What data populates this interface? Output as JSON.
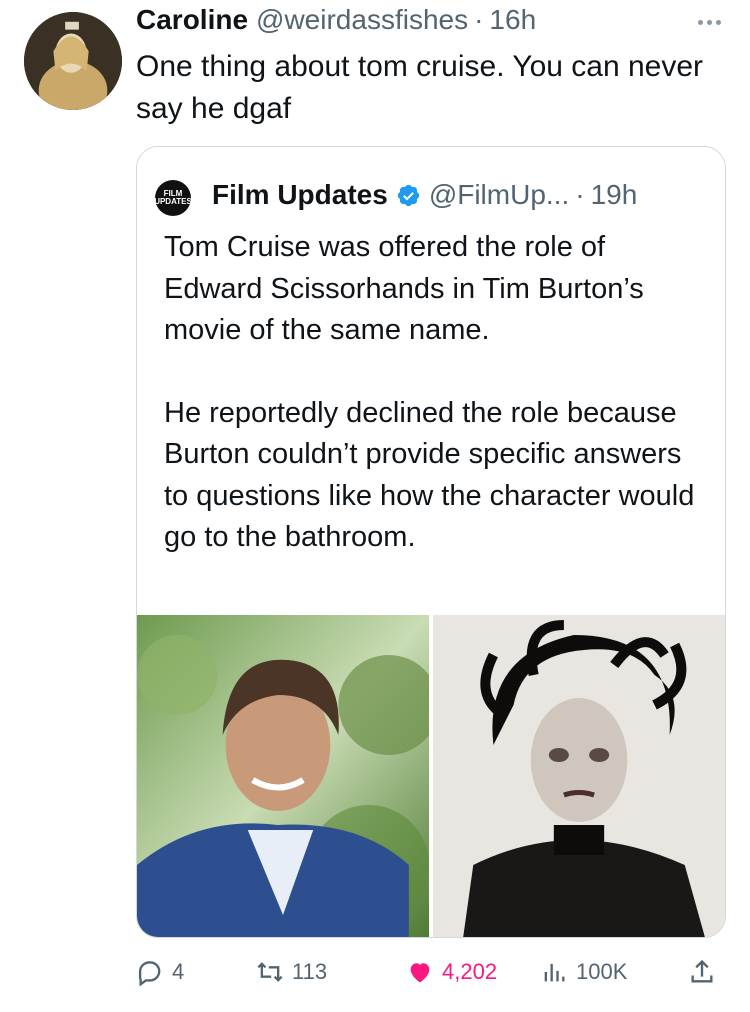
{
  "tweet": {
    "author_name": "Caroline",
    "author_handle": "@weirdassfishes",
    "separator": "·",
    "time": "16h",
    "text": "One thing about tom cruise. You can never say he dgaf",
    "more_icon": "more-horizontal-icon"
  },
  "quoted": {
    "avatar_label": "FILM UPDATES",
    "author_name": "Film Updates",
    "verified_icon": "verified-badge-icon",
    "author_handle": "@FilmUp...",
    "separator": "·",
    "time": "19h",
    "paragraphs": [
      "Tom Cruise was offered the role of Edward Scissorhands in Tim Burton’s movie of the same name.",
      "He reportedly declined the role because Burton couldn’t provide specific answers to questions like how the character would go to the bathroom."
    ],
    "media": [
      "photo-tom-cruise",
      "photo-edward-scissorhands"
    ]
  },
  "actions": {
    "replies": "4",
    "retweets": "113",
    "likes": "4,202",
    "views": "100K",
    "like_color": "#f91880",
    "icons": [
      "reply-icon",
      "retweet-icon",
      "like-icon",
      "views-icon",
      "share-icon"
    ]
  },
  "colors": {
    "text": "#0f1419",
    "secondary": "#536471",
    "border": "#cfd9de",
    "verified": "#1d9bf0"
  }
}
